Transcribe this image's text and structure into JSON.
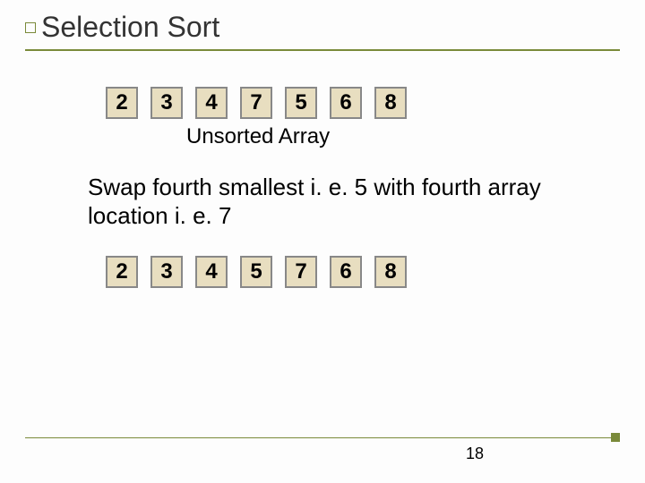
{
  "title": "Selection Sort",
  "array1": [
    "2",
    "3",
    "4",
    "7",
    "5",
    "6",
    "8"
  ],
  "caption1": "Unsorted Array",
  "body": "Swap fourth smallest i. e. 5 with fourth array location i. e. 7",
  "array2": [
    "2",
    "3",
    "4",
    "5",
    "7",
    "6",
    "8"
  ],
  "page": "18"
}
